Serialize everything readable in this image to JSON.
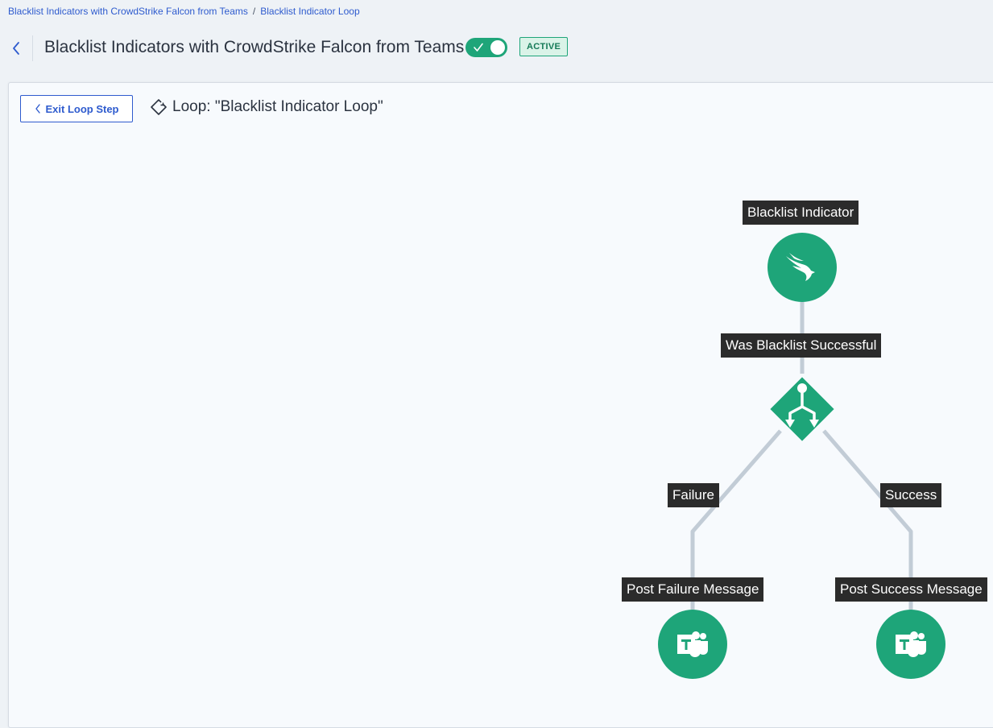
{
  "breadcrumb": {
    "items": [
      "Blacklist Indicators with CrowdStrike Falcon from Teams",
      "Blacklist Indicator Loop"
    ],
    "separator": "/"
  },
  "header": {
    "title": "Blacklist Indicators with CrowdStrike Falcon from Teams",
    "toggle_on": true,
    "status_badge": "ACTIVE"
  },
  "loop": {
    "exit_button": "Exit Loop Step",
    "title": "Loop: \"Blacklist Indicator Loop\""
  },
  "flow": {
    "nodes": {
      "blacklist_indicator": {
        "label": "Blacklist Indicator",
        "icon": "crowdstrike-falcon-icon"
      },
      "decision": {
        "label": "Was Blacklist Successful",
        "icon": "branch-split-icon"
      },
      "post_failure": {
        "label": "Post Failure Message",
        "icon": "teams-icon"
      },
      "post_success": {
        "label": "Post Success Message",
        "icon": "teams-icon"
      }
    },
    "edges": {
      "failure": "Failure",
      "success": "Success"
    }
  },
  "colors": {
    "accent": "#2e5bce",
    "node_green": "#1ea579",
    "edge": "#c2ccd6",
    "label_bg": "#2b2b2b"
  }
}
